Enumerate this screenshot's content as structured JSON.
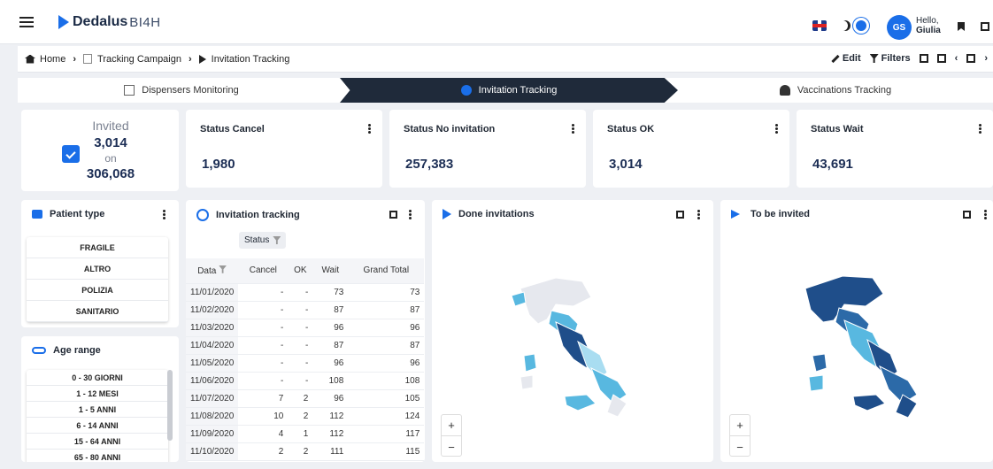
{
  "header": {
    "brand": "Dedalus",
    "brand_sub": "BI4H",
    "hello": "Hello,",
    "user_name": "Giulia",
    "user_initials": "GS"
  },
  "breadcrumb": [
    "Home",
    "Tracking Campaign",
    "Invitation Tracking"
  ],
  "toolbar": {
    "edit": "Edit",
    "filters": "Filters"
  },
  "steps": [
    "Dispensers Monitoring",
    "Invitation Tracking",
    "Vaccinations Tracking"
  ],
  "invited": {
    "label": "Invited",
    "value": "3,014",
    "on": "on",
    "total": "306,068"
  },
  "kpis": [
    {
      "title": "Status Cancel",
      "value": "1,980"
    },
    {
      "title": "Status No invitation",
      "value": "257,383"
    },
    {
      "title": "Status OK",
      "value": "3,014"
    },
    {
      "title": "Status Wait",
      "value": "43,691"
    }
  ],
  "patient_type": {
    "title": "Patient type",
    "items": [
      "FRAGILE",
      "ALTRO",
      "POLIZIA",
      "SANITARIO"
    ]
  },
  "age_range": {
    "title": "Age range",
    "items": [
      "0 - 30 GIORNI",
      "1 - 12 MESI",
      "1 - 5 ANNI",
      "6 - 14 ANNI",
      "15 - 64 ANNI",
      "65 - 80 ANNI"
    ]
  },
  "pivot": {
    "title": "Invitation tracking",
    "status_chip": "Status",
    "headers": [
      "Data",
      "Cancel",
      "OK",
      "Wait",
      "Grand Total"
    ],
    "rows": [
      [
        "11/01/2020",
        "-",
        "-",
        "73",
        "73"
      ],
      [
        "11/02/2020",
        "-",
        "-",
        "87",
        "87"
      ],
      [
        "11/03/2020",
        "-",
        "-",
        "96",
        "96"
      ],
      [
        "11/04/2020",
        "-",
        "-",
        "87",
        "87"
      ],
      [
        "11/05/2020",
        "-",
        "-",
        "96",
        "96"
      ],
      [
        "11/06/2020",
        "-",
        "-",
        "108",
        "108"
      ],
      [
        "11/07/2020",
        "7",
        "2",
        "96",
        "105"
      ],
      [
        "11/08/2020",
        "10",
        "2",
        "112",
        "124"
      ],
      [
        "11/09/2020",
        "4",
        "1",
        "112",
        "117"
      ],
      [
        "11/10/2020",
        "2",
        "2",
        "111",
        "115"
      ]
    ]
  },
  "maps": [
    {
      "title": "Done invitations"
    },
    {
      "title": "To be invited"
    }
  ],
  "zoom": {
    "plus": "+",
    "minus": "−"
  },
  "colors": {
    "accent": "#1a6ee8",
    "dark_step": "#1f2a3a",
    "map_dark": "#1f4e8a",
    "map_light": "#58b8e0"
  }
}
